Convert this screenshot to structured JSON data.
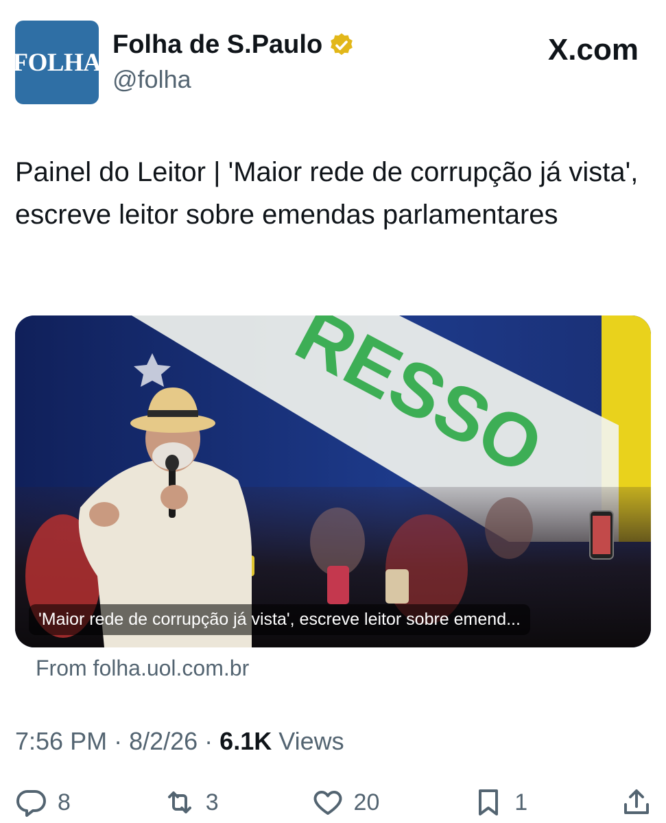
{
  "account": {
    "avatar_text": "FOLHA",
    "display_name": "Folha de S.Paulo",
    "handle": "@folha",
    "verified_icon": "gold-verified-badge-icon"
  },
  "site_label": "X.com",
  "tweet": {
    "text": "Painel do Leitor | 'Maior rede de corrupção já vista', escreve leitor sobre emendas parlamentares"
  },
  "card": {
    "caption": "'Maior rede de corrupção já vista', escreve leitor sobre emend...",
    "source": "From folha.uol.com.br",
    "banner_text": "RESSO"
  },
  "meta": {
    "time": "7:56 PM",
    "separator": "·",
    "date": "8/2/26",
    "views_count": "6.1K",
    "views_label": "Views"
  },
  "actions": {
    "replies": "8",
    "reposts": "3",
    "likes": "20",
    "bookmarks": "1"
  },
  "colors": {
    "avatar_bg": "#2f6fa5",
    "verified_gold": "#e2b719",
    "muted_text": "#536471",
    "primary_text": "#0f1419"
  }
}
